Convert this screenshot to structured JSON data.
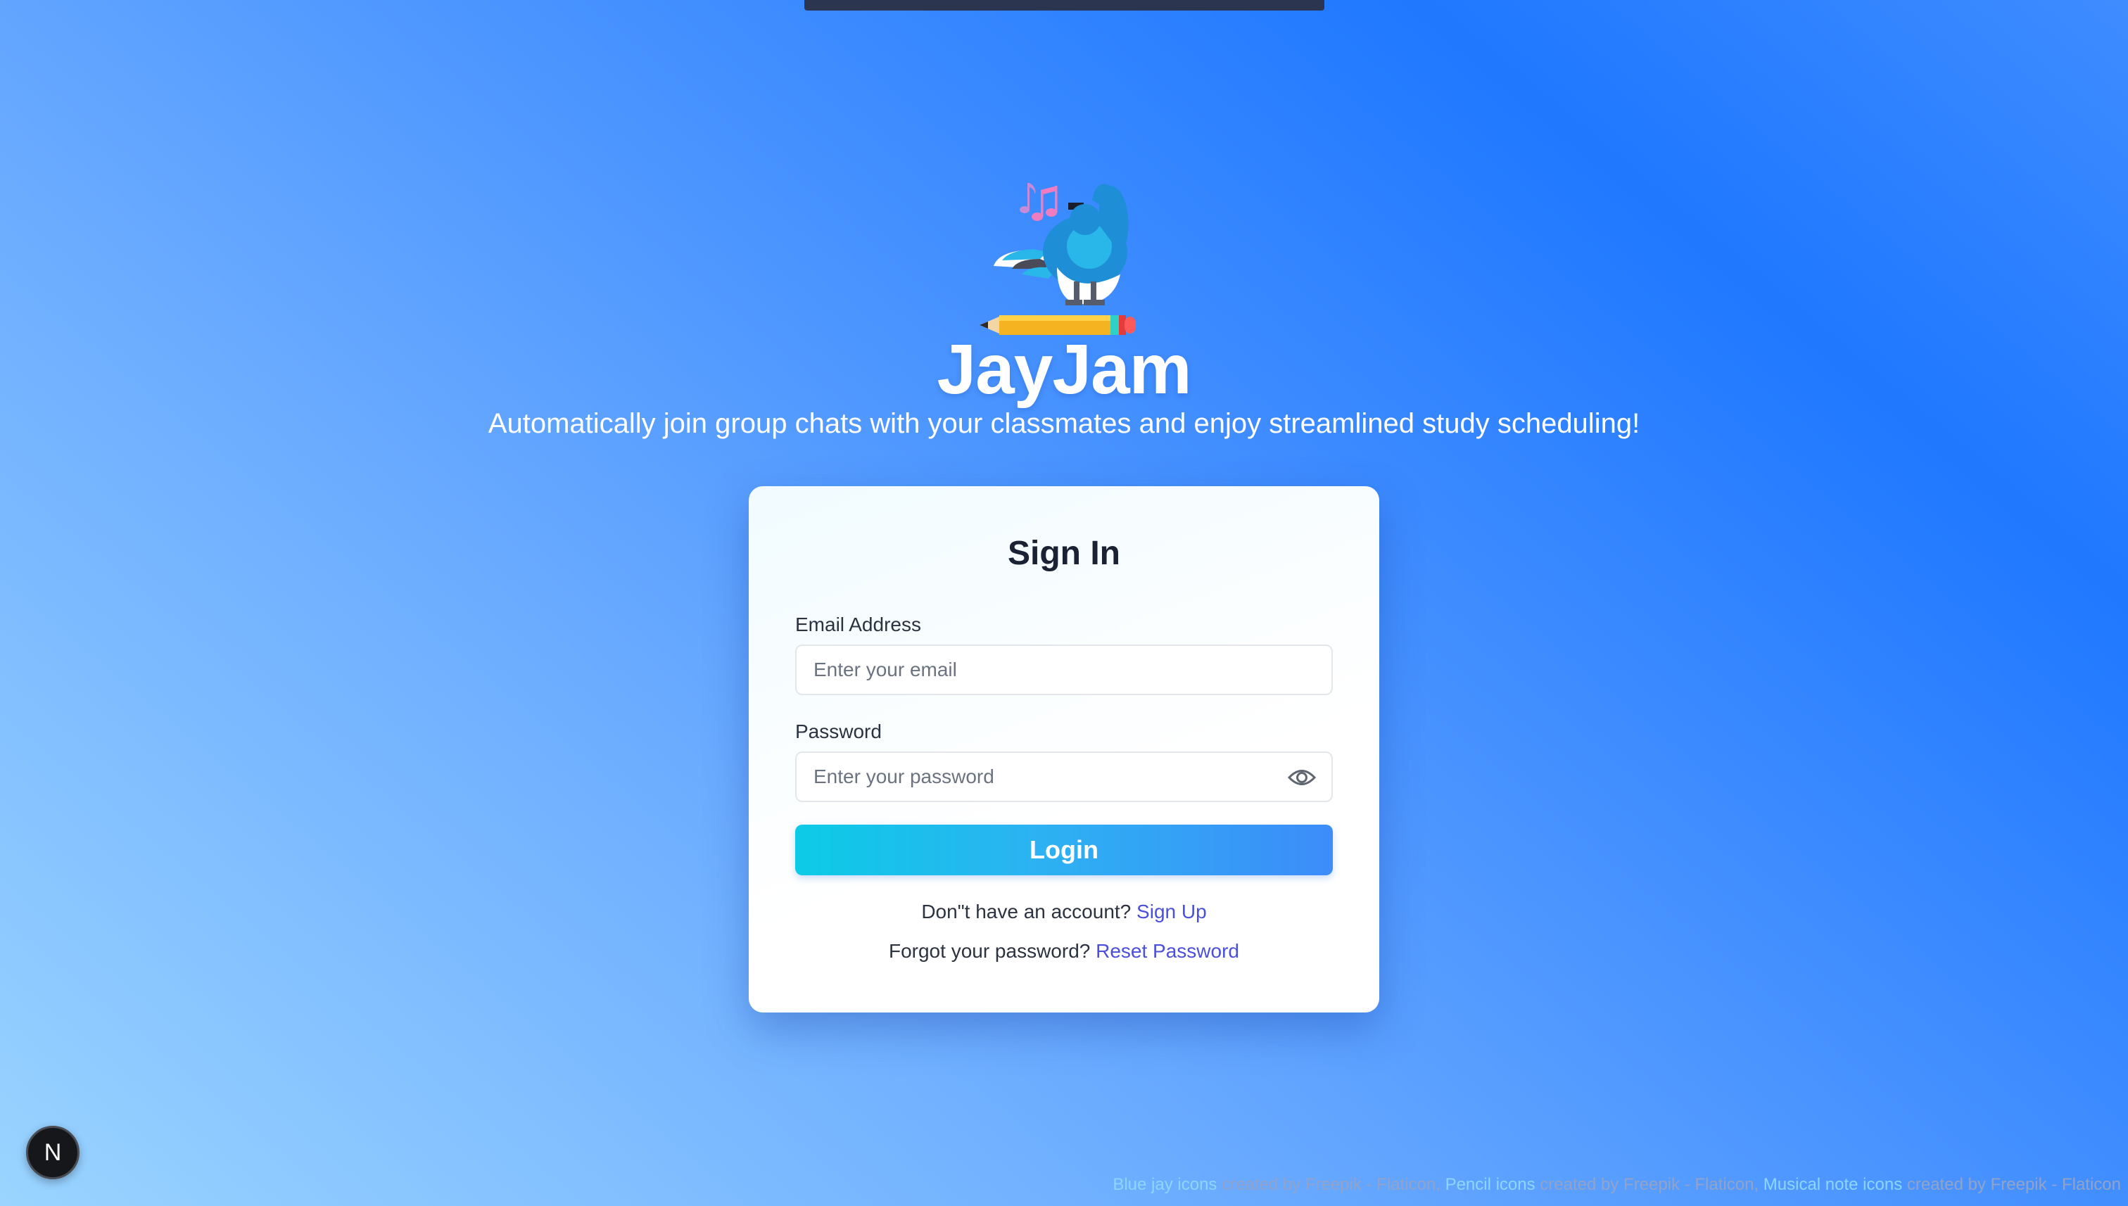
{
  "app": {
    "title": "JayJam",
    "tagline": "Automatically join group chats with your classmates and enjoy streamlined study scheduling!",
    "logo_icon": "blue-jay-on-pencil-with-music-notes"
  },
  "signin": {
    "title": "Sign In",
    "email_label": "Email Address",
    "email_placeholder": "Enter your email",
    "email_value": "",
    "password_label": "Password",
    "password_placeholder": "Enter your password",
    "password_value": "",
    "show_password_icon": "eye-icon",
    "login_label": "Login",
    "signup_prompt": "Don\"t have an account?",
    "signup_link": "Sign Up",
    "reset_prompt": "Forgot your password?",
    "reset_link": "Reset Password"
  },
  "dev_badge": {
    "letter": "N"
  },
  "credits": {
    "part1": "Blue jay icons",
    "part2": " created by Freepik - Flaticon, ",
    "part3": "Pencil icons",
    "part4": " created by Freepik - Flaticon, ",
    "part5": "Musical note icons",
    "part6": " created by Freepik - Flaticon"
  },
  "colors": {
    "background_start": "#9ad4ff",
    "background_end": "#1f78ff",
    "button_start": "#0ccbe6",
    "button_end": "#3d8cf9",
    "link": "#4a4fdc"
  }
}
